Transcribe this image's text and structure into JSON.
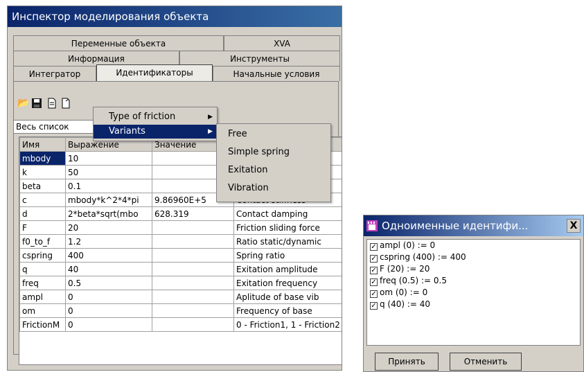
{
  "inspector": {
    "title": "Инспектор моделирования объекта",
    "tabs_row1": [
      "Переменные объекта",
      "XVA"
    ],
    "tabs_row2": [
      "Информация",
      "Инструменты"
    ],
    "tabs_row3": [
      "Интегратор",
      "Идентификаторы",
      "Начальные условия"
    ],
    "combo_value": "Весь список",
    "columns": [
      "Имя",
      "Выражение",
      "Значение",
      ""
    ],
    "rows": [
      [
        "mbody",
        "10",
        "",
        ""
      ],
      [
        "k",
        "50",
        "",
        ""
      ],
      [
        "beta",
        "0.1",
        "",
        ""
      ],
      [
        "c",
        "mbody*k^2*4*pi",
        "9.86960E+5",
        "Contact stiffness"
      ],
      [
        "d",
        "2*beta*sqrt(mbo",
        "628.319",
        "Contact damping"
      ],
      [
        "F",
        "20",
        "",
        "Friction sliding force"
      ],
      [
        "f0_to_f",
        "1.2",
        "",
        "Ratio static/dynamic"
      ],
      [
        "cspring",
        "400",
        "",
        "Spring ratio"
      ],
      [
        "q",
        "40",
        "",
        "Exitation amplitude"
      ],
      [
        "freq",
        "0.5",
        "",
        "Exitation frequency"
      ],
      [
        "ampl",
        "0",
        "",
        "Aplitude of base vib"
      ],
      [
        "om",
        "0",
        "",
        "Frequency of base"
      ],
      [
        "FrictionM",
        "0",
        "",
        "0 - Friction1, 1 - Friction2"
      ]
    ]
  },
  "context_menu": {
    "items": [
      "Type of friction",
      "Variants"
    ],
    "submenu": [
      "Free",
      "Simple spring",
      "Exitation",
      "Vibration"
    ]
  },
  "dialog": {
    "title": "Одноименные идентифи...",
    "close_label": "X",
    "items": [
      "ampl (0) := 0",
      "cspring (400) := 400",
      "F (20) := 20",
      "freq (0.5) := 0.5",
      "om (0) := 0",
      "q (40) := 40"
    ],
    "accept_label": "Принять",
    "cancel_label": "Отменить"
  },
  "icons": [
    "open-folder-icon",
    "save-icon",
    "document-icon",
    "export-icon",
    "submenu-arrow-icon",
    "app-icon",
    "checkbox-icon"
  ],
  "colors": {
    "titlebar": "#0a246a",
    "selection": "#0a246a",
    "face": "#d4d0c8"
  }
}
